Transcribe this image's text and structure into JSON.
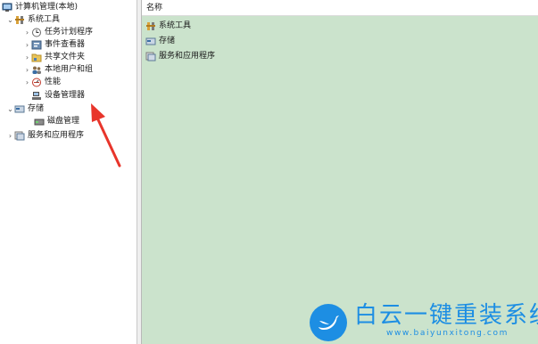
{
  "tree": {
    "root": "计算机管理(本地)",
    "system_tools": "系统工具",
    "task_scheduler": "任务计划程序",
    "event_viewer": "事件查看器",
    "shared_folders": "共享文件夹",
    "local_users_groups": "本地用户和组",
    "performance": "性能",
    "device_manager": "设备管理器",
    "storage": "存储",
    "disk_management": "磁盘管理",
    "services_apps": "服务和应用程序"
  },
  "list": {
    "column_name": "名称",
    "rows": [
      "系统工具",
      "存储",
      "服务和应用程序"
    ]
  },
  "watermark": {
    "title": "白云一键重装系统",
    "url": "www.baiyunxitong.com"
  },
  "colors": {
    "list_background": "#cbe3cc",
    "arrow": "#e8352b",
    "watermark": "#1d8ee3"
  }
}
